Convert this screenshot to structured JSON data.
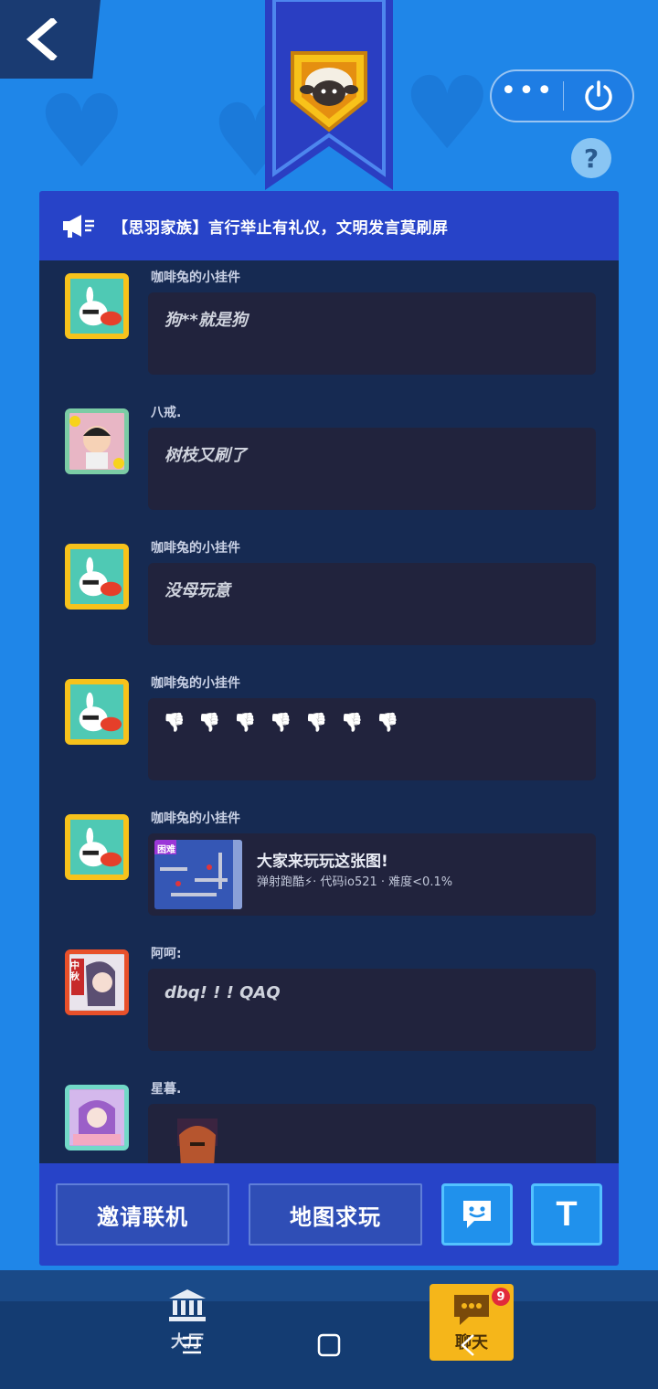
{
  "header": {
    "back_icon": "chevron-left-icon",
    "more_icon": "more-dots-icon",
    "power_icon": "power-icon",
    "help_label": "?"
  },
  "notice": {
    "icon": "megaphone-icon",
    "text": "【思羽家族】言行举止有礼仪，文明发言莫刷屏"
  },
  "messages": [
    {
      "name": "咖啡兔的小挂件",
      "text": "狗**就是狗"
    },
    {
      "name": "八戒.",
      "text": "树枝又刷了"
    },
    {
      "name": "咖啡兔的小挂件",
      "text": "没母玩意"
    },
    {
      "name": "咖啡兔的小挂件",
      "thumbs_icon": "thumbs-down-icon",
      "thumbs_count": 7
    },
    {
      "name": "咖啡兔的小挂件",
      "map_title": "大家来玩玩这张图!",
      "map_desc": "弹射跑酷⚡· 代码io521 · 难度<0.1%",
      "map_tag": "困难"
    },
    {
      "name": "阿呵:",
      "text": "dbq! ! ! QAQ"
    },
    {
      "name": "星暮.",
      "text": ""
    }
  ],
  "avatar_extra": {
    "festival_tag": "中秋"
  },
  "buttons": {
    "invite": "邀请联机",
    "map_request": "地图求玩",
    "emoji_icon": "emoji-chat-icon",
    "text_icon": "T"
  },
  "tabbar": {
    "hall_label": "大厅",
    "chat_label": "聊天",
    "chat_badge": "9"
  },
  "colors": {
    "background": "#1f86e8",
    "panel": "#2743c8",
    "chat_bg": "#162a52",
    "bubble": "#21233d",
    "accent_yellow": "#f5b61a"
  }
}
